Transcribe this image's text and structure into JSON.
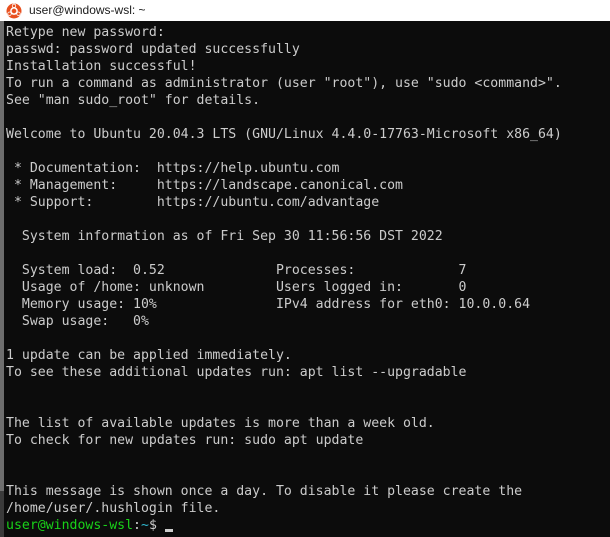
{
  "titlebar": {
    "icon_name": "ubuntu-logo-icon",
    "title": "user@windows-wsl: ~"
  },
  "terminal": {
    "background_color": "#0c0c0c",
    "foreground_color": "#cccccc",
    "prompt_user_color": "#19d219",
    "prompt_path_color": "#2fb8cf",
    "lines": [
      "Retype new password:",
      "passwd: password updated successfully",
      "Installation successful!",
      "To run a command as administrator (user \"root\"), use \"sudo <command>\".",
      "See \"man sudo_root\" for details.",
      "",
      "Welcome to Ubuntu 20.04.3 LTS (GNU/Linux 4.4.0-17763-Microsoft x86_64)",
      "",
      " * Documentation:  https://help.ubuntu.com",
      " * Management:     https://landscape.canonical.com",
      " * Support:        https://ubuntu.com/advantage",
      "",
      "  System information as of Fri Sep 30 11:56:56 DST 2022",
      "",
      "  System load:  0.52              Processes:             7",
      "  Usage of /home: unknown         Users logged in:       0",
      "  Memory usage: 10%               IPv4 address for eth0: 10.0.0.64",
      "  Swap usage:   0%",
      "",
      "1 update can be applied immediately.",
      "To see these additional updates run: apt list --upgradable",
      "",
      "",
      "The list of available updates is more than a week old.",
      "To check for new updates run: sudo apt update",
      "",
      "",
      "This message is shown once a day. To disable it please create the",
      "/home/user/.hushlogin file."
    ],
    "prompt": {
      "user_host": "user@windows-wsl",
      "separator": ":",
      "path": "~",
      "symbol": "$",
      "cursor": "block-cursor"
    }
  }
}
